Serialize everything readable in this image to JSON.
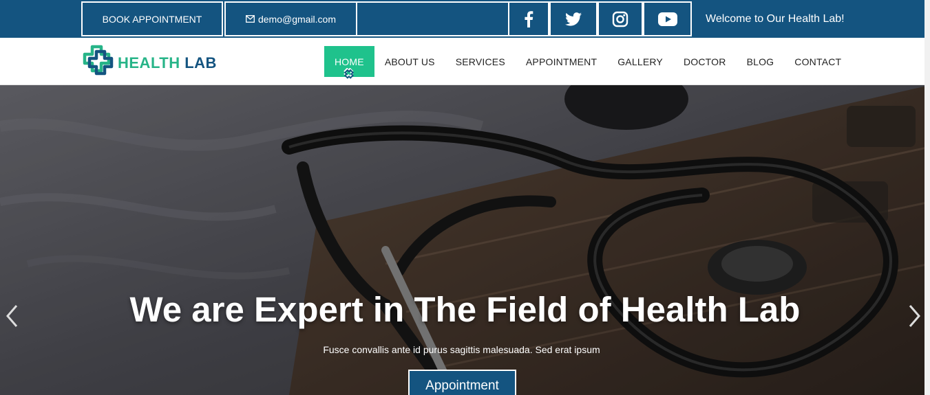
{
  "topbar": {
    "book_label": "BOOK APPOINTMENT",
    "email": "demo@gmail.com",
    "welcome": "Welcome to Our Health Lab!",
    "social": [
      "facebook-icon",
      "twitter-icon",
      "instagram-icon",
      "youtube-icon"
    ],
    "bg_color": "#145480"
  },
  "logo": {
    "word1": "HEALTH",
    "word2": "LAB",
    "color1": "#27b488",
    "color2": "#145480"
  },
  "nav": {
    "items": [
      {
        "label": "HOME",
        "active": true
      },
      {
        "label": "ABOUT US"
      },
      {
        "label": "SERVICES"
      },
      {
        "label": "APPOINTMENT"
      },
      {
        "label": "GALLERY"
      },
      {
        "label": "DOCTOR"
      },
      {
        "label": "BLOG"
      },
      {
        "label": "CONTACT"
      }
    ],
    "active_color": "#1fc28c"
  },
  "hero": {
    "title": "We are Expert in The Field of Health Lab",
    "subtitle": "Fusce convallis ante id purus sagittis malesuada. Sed erat ipsum",
    "button_label": "Appointment",
    "prev_icon": "chevron-left-icon",
    "next_icon": "chevron-right-icon"
  }
}
